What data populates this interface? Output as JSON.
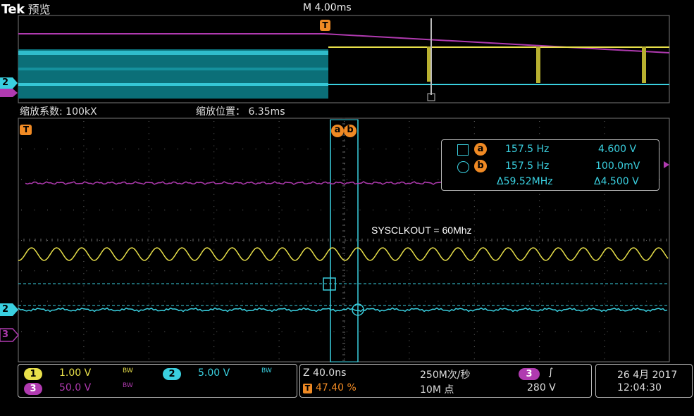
{
  "header": {
    "brand": "Tek",
    "mode": "预览",
    "timebase": "M 4.00ms"
  },
  "overview": {
    "zoom_factor_label": "缩放系数: 100kX",
    "zoom_position_label": "缩放位置： 6.35ms"
  },
  "markers": {
    "trigger": "T",
    "cursor_a": "a",
    "cursor_b": "b",
    "ch2": "2",
    "ch3": "3"
  },
  "measurement": {
    "row_a": {
      "cursor": "a",
      "freq": "157.5 Hz",
      "value": "4.600 V"
    },
    "row_b": {
      "cursor": "b",
      "freq": "157.5 Hz",
      "value": "100.0mV"
    },
    "row_delta": {
      "freq": "Δ59.52MHz",
      "value": "Δ4.500 V"
    }
  },
  "annotation": "SYSCLKOUT = 60Mhz",
  "channels": {
    "ch1": {
      "num": "1",
      "scale": "1.00 V",
      "bw": "BW",
      "color": "#e8e04a"
    },
    "ch2": {
      "num": "2",
      "scale": "5.00 V",
      "bw": "BW",
      "color": "#3ad0e0"
    },
    "ch3": {
      "num": "3",
      "scale": "50.0 V",
      "bw": "BW",
      "color": "#b03ab0"
    }
  },
  "horizontal": {
    "zoom_time": "Z 40.0ns",
    "trigger_pos": "47.40 %",
    "trigger_letter": "T",
    "sample_rate": "250M次/秒",
    "record_length": "10M 点"
  },
  "trigger": {
    "channel": "3",
    "slope": "∫",
    "level": "280 V"
  },
  "datetime": {
    "date": "26 4月 2017",
    "time": "12:04:30"
  },
  "colors": {
    "ch1": "#e8e04a",
    "ch2": "#3ad0e0",
    "ch3": "#b03ab0",
    "cursor": "#f08a24",
    "grid": "#5a5a5a"
  }
}
